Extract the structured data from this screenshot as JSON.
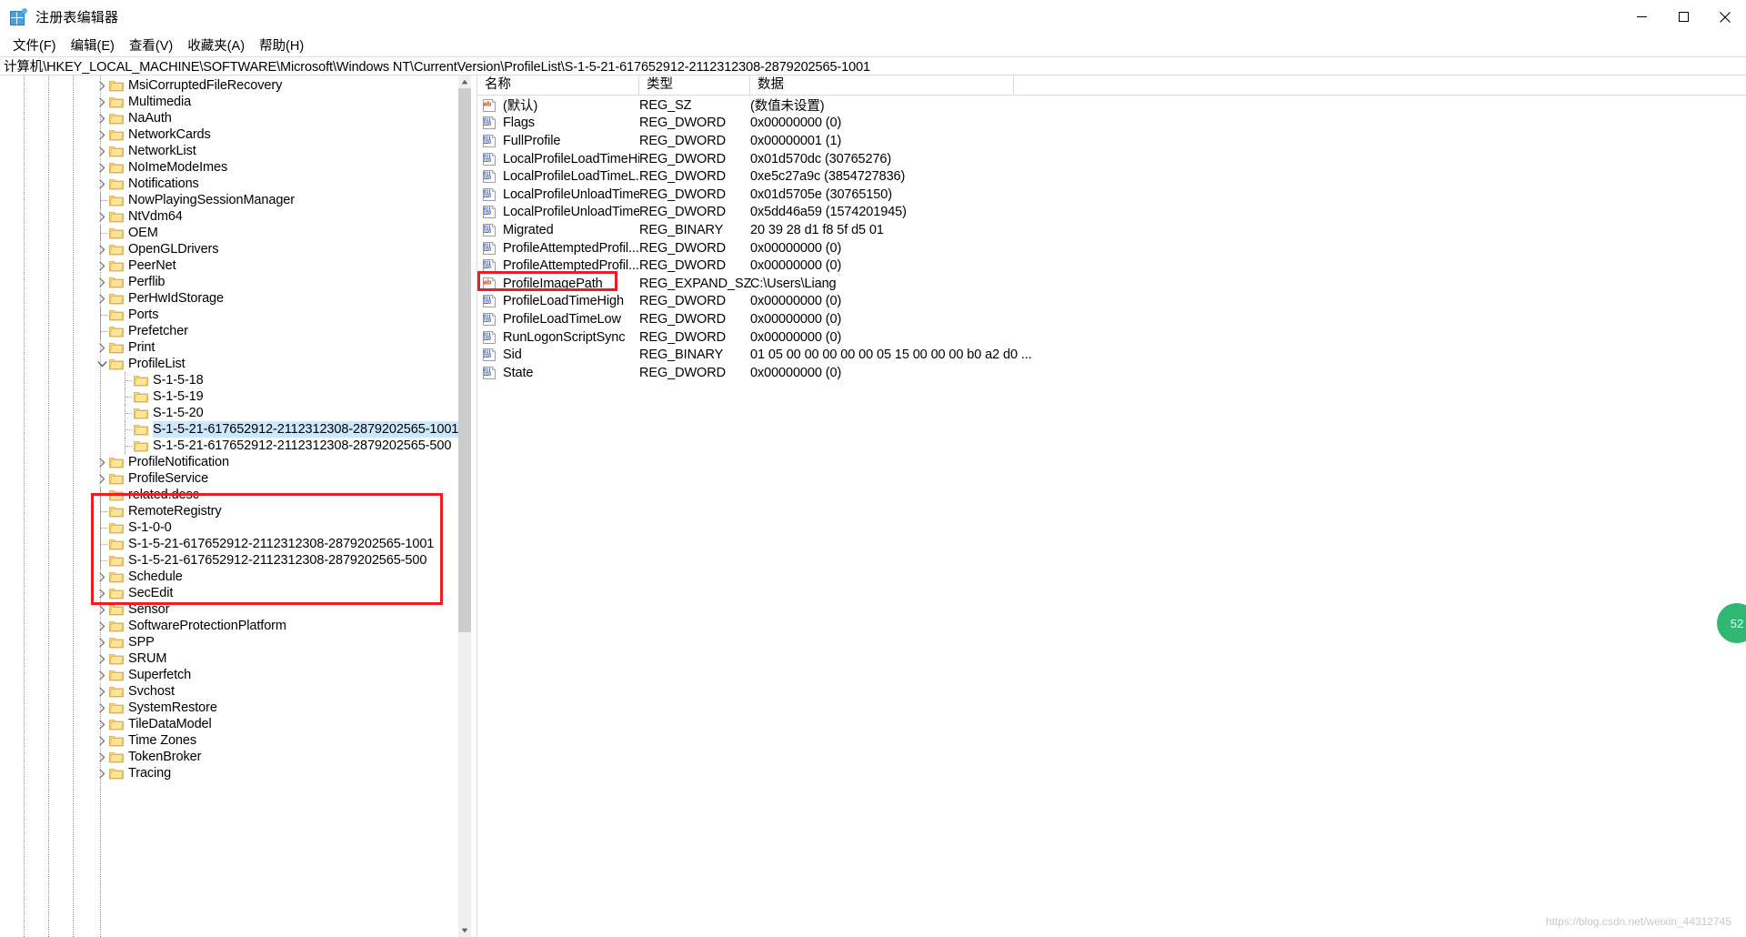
{
  "window": {
    "title": "注册表编辑器",
    "icon": "registry-editor-icon",
    "minimize_label": "最小化",
    "maximize_label": "最大化",
    "close_label": "关闭"
  },
  "menu": {
    "items": [
      {
        "label": "文件(F)",
        "name": "menu-file"
      },
      {
        "label": "编辑(E)",
        "name": "menu-edit"
      },
      {
        "label": "查看(V)",
        "name": "menu-view"
      },
      {
        "label": "收藏夹(A)",
        "name": "menu-favorites"
      },
      {
        "label": "帮助(H)",
        "name": "menu-help"
      }
    ]
  },
  "address": {
    "path": "计算机\\HKEY_LOCAL_MACHINE\\SOFTWARE\\Microsoft\\Windows NT\\CurrentVersion\\ProfileList\\S-1-5-21-617652912-2112312308-2879202565-1001"
  },
  "tree": {
    "items": [
      {
        "label": "MsiCorruptedFileRecovery",
        "depth": 1,
        "twisty": "collapsed",
        "selected": false
      },
      {
        "label": "Multimedia",
        "depth": 1,
        "twisty": "collapsed",
        "selected": false
      },
      {
        "label": "NaAuth",
        "depth": 1,
        "twisty": "collapsed",
        "selected": false
      },
      {
        "label": "NetworkCards",
        "depth": 1,
        "twisty": "collapsed",
        "selected": false
      },
      {
        "label": "NetworkList",
        "depth": 1,
        "twisty": "collapsed",
        "selected": false
      },
      {
        "label": "NoImeModeImes",
        "depth": 1,
        "twisty": "collapsed",
        "selected": false
      },
      {
        "label": "Notifications",
        "depth": 1,
        "twisty": "collapsed",
        "selected": false
      },
      {
        "label": "NowPlayingSessionManager",
        "depth": 1,
        "twisty": "none",
        "selected": false
      },
      {
        "label": "NtVdm64",
        "depth": 1,
        "twisty": "collapsed",
        "selected": false
      },
      {
        "label": "OEM",
        "depth": 1,
        "twisty": "none",
        "selected": false
      },
      {
        "label": "OpenGLDrivers",
        "depth": 1,
        "twisty": "collapsed",
        "selected": false
      },
      {
        "label": "PeerNet",
        "depth": 1,
        "twisty": "collapsed",
        "selected": false
      },
      {
        "label": "Perflib",
        "depth": 1,
        "twisty": "collapsed",
        "selected": false
      },
      {
        "label": "PerHwIdStorage",
        "depth": 1,
        "twisty": "collapsed",
        "selected": false
      },
      {
        "label": "Ports",
        "depth": 1,
        "twisty": "none",
        "selected": false
      },
      {
        "label": "Prefetcher",
        "depth": 1,
        "twisty": "none",
        "selected": false
      },
      {
        "label": "Print",
        "depth": 1,
        "twisty": "collapsed",
        "selected": false
      },
      {
        "label": "ProfileList",
        "depth": 1,
        "twisty": "expanded",
        "selected": false
      },
      {
        "label": "S-1-5-18",
        "depth": 2,
        "twisty": "none",
        "selected": false
      },
      {
        "label": "S-1-5-19",
        "depth": 2,
        "twisty": "none",
        "selected": false
      },
      {
        "label": "S-1-5-20",
        "depth": 2,
        "twisty": "none",
        "selected": false
      },
      {
        "label": "S-1-5-21-617652912-2112312308-2879202565-1001",
        "depth": 2,
        "twisty": "none",
        "selected": true
      },
      {
        "label": "S-1-5-21-617652912-2112312308-2879202565-500",
        "depth": 2,
        "twisty": "none",
        "selected": false
      },
      {
        "label": "ProfileNotification",
        "depth": 1,
        "twisty": "collapsed",
        "selected": false
      },
      {
        "label": "ProfileService",
        "depth": 1,
        "twisty": "collapsed",
        "selected": false
      },
      {
        "label": "related.desc",
        "depth": 1,
        "twisty": "none",
        "selected": false
      },
      {
        "label": "RemoteRegistry",
        "depth": 1,
        "twisty": "none",
        "selected": false
      },
      {
        "label": "S-1-0-0",
        "depth": 1,
        "twisty": "none",
        "selected": false
      },
      {
        "label": "S-1-5-21-617652912-2112312308-2879202565-1001",
        "depth": 1,
        "twisty": "none",
        "selected": false
      },
      {
        "label": "S-1-5-21-617652912-2112312308-2879202565-500",
        "depth": 1,
        "twisty": "none",
        "selected": false
      },
      {
        "label": "Schedule",
        "depth": 1,
        "twisty": "collapsed",
        "selected": false
      },
      {
        "label": "SecEdit",
        "depth": 1,
        "twisty": "collapsed",
        "selected": false
      },
      {
        "label": "Sensor",
        "depth": 1,
        "twisty": "collapsed",
        "selected": false
      },
      {
        "label": "SoftwareProtectionPlatform",
        "depth": 1,
        "twisty": "collapsed",
        "selected": false
      },
      {
        "label": "SPP",
        "depth": 1,
        "twisty": "collapsed",
        "selected": false
      },
      {
        "label": "SRUM",
        "depth": 1,
        "twisty": "collapsed",
        "selected": false
      },
      {
        "label": "Superfetch",
        "depth": 1,
        "twisty": "collapsed",
        "selected": false
      },
      {
        "label": "Svchost",
        "depth": 1,
        "twisty": "collapsed",
        "selected": false
      },
      {
        "label": "SystemRestore",
        "depth": 1,
        "twisty": "collapsed",
        "selected": false
      },
      {
        "label": "TileDataModel",
        "depth": 1,
        "twisty": "collapsed",
        "selected": false
      },
      {
        "label": "Time Zones",
        "depth": 1,
        "twisty": "collapsed",
        "selected": false
      },
      {
        "label": "TokenBroker",
        "depth": 1,
        "twisty": "collapsed",
        "selected": false
      },
      {
        "label": "Tracing",
        "depth": 1,
        "twisty": "collapsed",
        "selected": false
      }
    ]
  },
  "values": {
    "columns": {
      "name": "名称",
      "type": "类型",
      "data": "数据"
    },
    "rows": [
      {
        "icon": "string-value-icon",
        "name": "(默认)",
        "type": "REG_SZ",
        "data": "(数值未设置)",
        "highlighted": false
      },
      {
        "icon": "dword-value-icon",
        "name": "Flags",
        "type": "REG_DWORD",
        "data": "0x00000000 (0)",
        "highlighted": false
      },
      {
        "icon": "dword-value-icon",
        "name": "FullProfile",
        "type": "REG_DWORD",
        "data": "0x00000001 (1)",
        "highlighted": false
      },
      {
        "icon": "dword-value-icon",
        "name": "LocalProfileLoadTimeHi...",
        "type": "REG_DWORD",
        "data": "0x01d570dc (30765276)",
        "highlighted": false
      },
      {
        "icon": "dword-value-icon",
        "name": "LocalProfileLoadTimeL...",
        "type": "REG_DWORD",
        "data": "0xe5c27a9c (3854727836)",
        "highlighted": false
      },
      {
        "icon": "dword-value-icon",
        "name": "LocalProfileUnloadTime...",
        "type": "REG_DWORD",
        "data": "0x01d5705e (30765150)",
        "highlighted": false
      },
      {
        "icon": "dword-value-icon",
        "name": "LocalProfileUnloadTime...",
        "type": "REG_DWORD",
        "data": "0x5dd46a59 (1574201945)",
        "highlighted": false
      },
      {
        "icon": "binary-value-icon",
        "name": "Migrated",
        "type": "REG_BINARY",
        "data": "20 39 28 d1 f8 5f d5 01",
        "highlighted": false
      },
      {
        "icon": "dword-value-icon",
        "name": "ProfileAttemptedProfil...",
        "type": "REG_DWORD",
        "data": "0x00000000 (0)",
        "highlighted": false
      },
      {
        "icon": "dword-value-icon",
        "name": "ProfileAttemptedProfil...",
        "type": "REG_DWORD",
        "data": "0x00000000 (0)",
        "highlighted": false
      },
      {
        "icon": "string-value-icon",
        "name": "ProfileImagePath",
        "type": "REG_EXPAND_SZ",
        "data": "C:\\Users\\Liang",
        "highlighted": true
      },
      {
        "icon": "dword-value-icon",
        "name": "ProfileLoadTimeHigh",
        "type": "REG_DWORD",
        "data": "0x00000000 (0)",
        "highlighted": false
      },
      {
        "icon": "dword-value-icon",
        "name": "ProfileLoadTimeLow",
        "type": "REG_DWORD",
        "data": "0x00000000 (0)",
        "highlighted": false
      },
      {
        "icon": "dword-value-icon",
        "name": "RunLogonScriptSync",
        "type": "REG_DWORD",
        "data": "0x00000000 (0)",
        "highlighted": false
      },
      {
        "icon": "binary-value-icon",
        "name": "Sid",
        "type": "REG_BINARY",
        "data": "01 05 00 00 00 00 00 05 15 00 00 00 b0 a2 d0 ...",
        "highlighted": false
      },
      {
        "icon": "dword-value-icon",
        "name": "State",
        "type": "REG_DWORD",
        "data": "0x00000000 (0)",
        "highlighted": false
      }
    ]
  },
  "annotations": {
    "tree_box_name": "red-highlight-box-profilelist",
    "value_box_name": "red-highlight-box-profileimagepath"
  },
  "side_widget": {
    "label": "52"
  },
  "watermark": {
    "text": "https://blog.csdn.net/weixin_44312745"
  },
  "colors": {
    "annotation_red": "#ee1c25",
    "selection_blue": "#cce8ff",
    "folder_yellow": "#ffd966",
    "accent_green": "#2eb872"
  }
}
